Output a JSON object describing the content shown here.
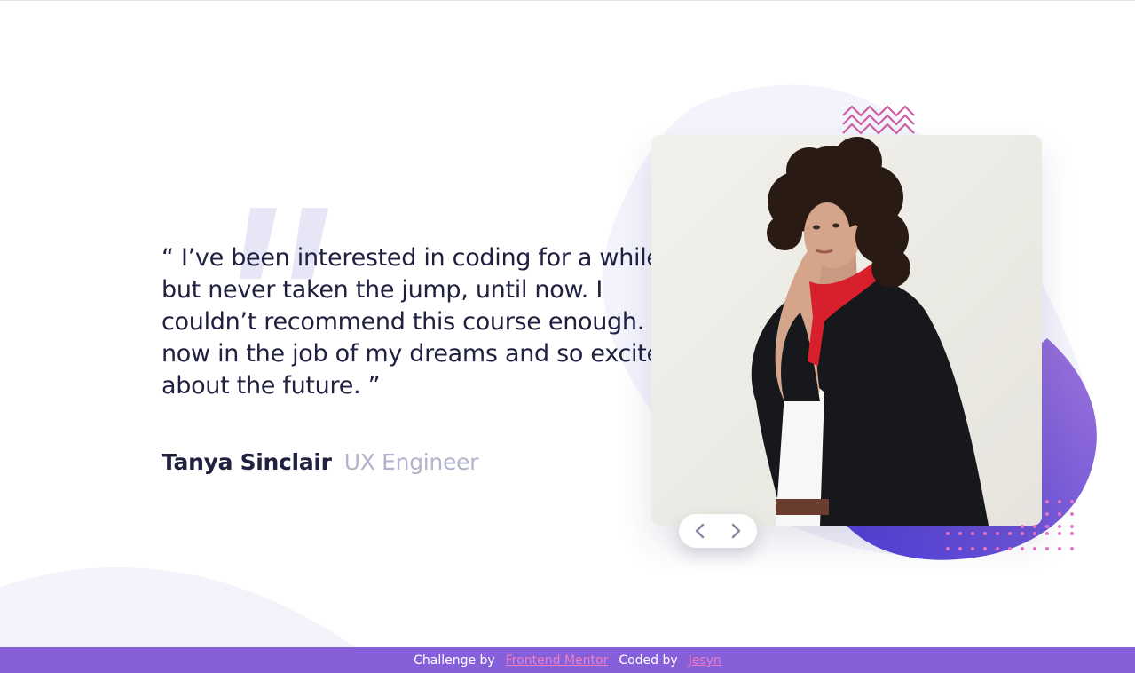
{
  "testimonial": {
    "quote": "“ I’ve been interested in coding for a while but never taken the jump, until now. I couldn’t recommend this course enough. I’m now in the job of my dreams and so excited about the future. ”",
    "author_name": "Tanya Sinclair",
    "author_role": "UX Engineer"
  },
  "slider": {
    "prev_icon": "chevron-left-icon",
    "next_icon": "chevron-right-icon"
  },
  "footer": {
    "challenge_label": "Challenge by",
    "challenge_link": "Frontend Mentor",
    "coded_label": "Coded by",
    "coded_link": "Jesyn"
  },
  "colors": {
    "text_dark": "#202040",
    "text_muted": "#b2b3cc",
    "accent_purple": "#8560d8",
    "accent_pink": "#f27cc0",
    "background_tint": "#f3f3fc"
  }
}
